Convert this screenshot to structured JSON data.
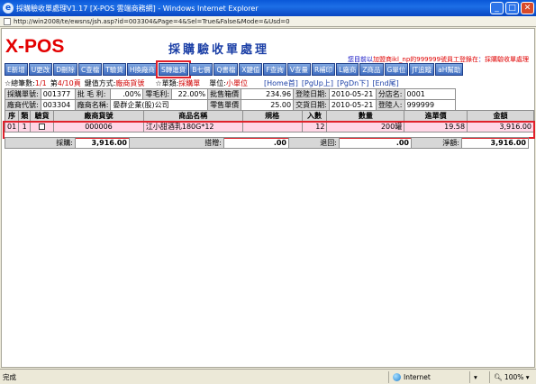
{
  "window": {
    "title": "採購驗收單處理V1.17 [X-POS 雲端商務網] - Windows Internet Explorer",
    "address": "http://win2008/te/ewsns/jsh.asp?id=003304&Page=4&Sel=True&False&Mode=&Usd=0"
  },
  "app": {
    "logo": "X-POS",
    "page_title": "採購驗收單處理",
    "user_note_prefix": "您目前以",
    "user_note_user": "加盟商ikl_np的999999號員工登錄在",
    "user_note_suffix": "：",
    "user_note_program": "採購驗收單處理"
  },
  "toolbar": {
    "buttons": [
      "E新增",
      "U更改",
      "D刪除",
      "C查檔",
      "T驗貨",
      "H換廠商",
      "S轉進貨",
      "B七價",
      "Q書檔",
      "X鍵值",
      "F查詢",
      "V查量",
      "R補印",
      "L廠商",
      "Z商品",
      "G單位",
      "JT追蹤",
      "aH幫助"
    ]
  },
  "status": {
    "total_label": "☆總筆數:",
    "total_value": "1/1",
    "page_label": "第",
    "page_value": "4/10頁",
    "key_label": "鍵值方式:",
    "key_value": "廠商貨號",
    "type_label": "☆單類:",
    "type_value": "採購單",
    "unit_label": "單位:",
    "unit_value": "小單位",
    "nav_home": "[Home首]",
    "nav_pgup": "[PgUp上]",
    "nav_pgdn": "[PgDn下]",
    "nav_end": "[End尾]"
  },
  "info": {
    "row1": {
      "l1": "採購單號:",
      "v1": "001377",
      "l2": "批 毛 利:",
      "v2": ".00%",
      "l3": "零毛利:",
      "v3": "22.00%",
      "l4": "批售箱價",
      "v4": "234.96",
      "l5": "登陸日期:",
      "v5": "2010-05-21",
      "l6": "分店名:",
      "v6": "0001"
    },
    "row2": {
      "l1": "廠商代號:",
      "v1": "003304",
      "l2": "廠商名稱:",
      "v2": "晏群企業(股)公司",
      "l4": "零售單價",
      "v4": "25.00",
      "l5": "交貨日期:",
      "v5": "2010-05-21",
      "l6": "登陸人:",
      "v6": "999999"
    }
  },
  "grid": {
    "headers": [
      "序",
      "類",
      "驗貨",
      "廠商貨號",
      "商品名稱",
      "規格",
      "入數",
      "數量",
      "進單價",
      "金額"
    ],
    "rows": [
      {
        "seq": "01",
        "type": "1",
        "vendor_code": "000006",
        "name": "江小甜酒乳180G*12",
        "spec": "",
        "pack": "12",
        "qty": "200罐",
        "price": "19.58",
        "amount": "3,916.00"
      }
    ]
  },
  "totals": {
    "purchase_label": "採購:",
    "purchase_value": "3,916.00",
    "discount_label": "搭贈:",
    "discount_value": ".00",
    "return_label": "退回:",
    "return_value": ".00",
    "net_label": "淨額:",
    "net_value": "3,916.00"
  },
  "statusbar": {
    "left": "完成",
    "zone": "Internet",
    "zoom": "100%"
  }
}
